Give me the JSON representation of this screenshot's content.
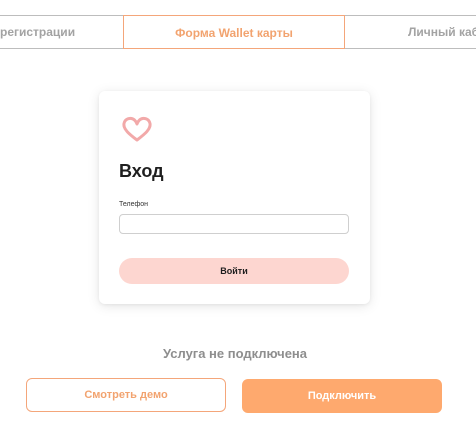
{
  "tabs": {
    "registration": "регистрации",
    "wallet": "Форма Wallet карты",
    "account": "Личный каб"
  },
  "login_card": {
    "logo_icon": "heart-outline-icon",
    "title": "Вход",
    "phone_label": "Телефон",
    "phone_value": "",
    "login_button": "Войти"
  },
  "status": {
    "text": "Услуга не подключена"
  },
  "actions": {
    "demo_button": "Смотреть демо",
    "connect_button": "Подключить"
  },
  "colors": {
    "accent": "#fea96e",
    "accent_text": "#f2a36f",
    "login_button_bg": "#fdd6d0",
    "heart": "#f2a9a9"
  }
}
